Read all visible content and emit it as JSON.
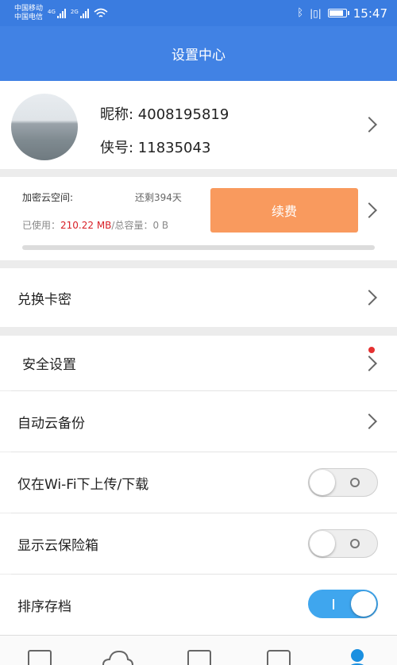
{
  "status_bar": {
    "carrier1": "中国移动",
    "carrier2": "中国电信",
    "net1": "4G",
    "net2": "2G",
    "time": "15:47"
  },
  "header": {
    "title": "设置中心"
  },
  "profile": {
    "nickname": "昵称: 4008195819",
    "account": "侠号: 11835043"
  },
  "storage": {
    "label": "加密云空间:",
    "remaining": "还剩394天",
    "used_prefix": "已使用：",
    "used_value": "210.22 MB",
    "total_text": "/总容量：0 B",
    "renew_label": "续费",
    "progress_fraction": 0.0
  },
  "menu": {
    "redeem": "兑换卡密",
    "security": "安全设置",
    "auto_backup": "自动云备份",
    "wifi_only": "仅在Wi-Fi下上传/下载",
    "show_vault": "显示云保险箱",
    "sort_archive": "排序存档"
  },
  "toggles": {
    "wifi_only": false,
    "show_vault": false,
    "sort_archive": true
  },
  "colors": {
    "header": "#4182e4",
    "accent_orange": "#f99a5e",
    "used_red": "#d81f26",
    "toggle_on": "#3fa6ee",
    "nav_active": "#1a8fe0"
  }
}
